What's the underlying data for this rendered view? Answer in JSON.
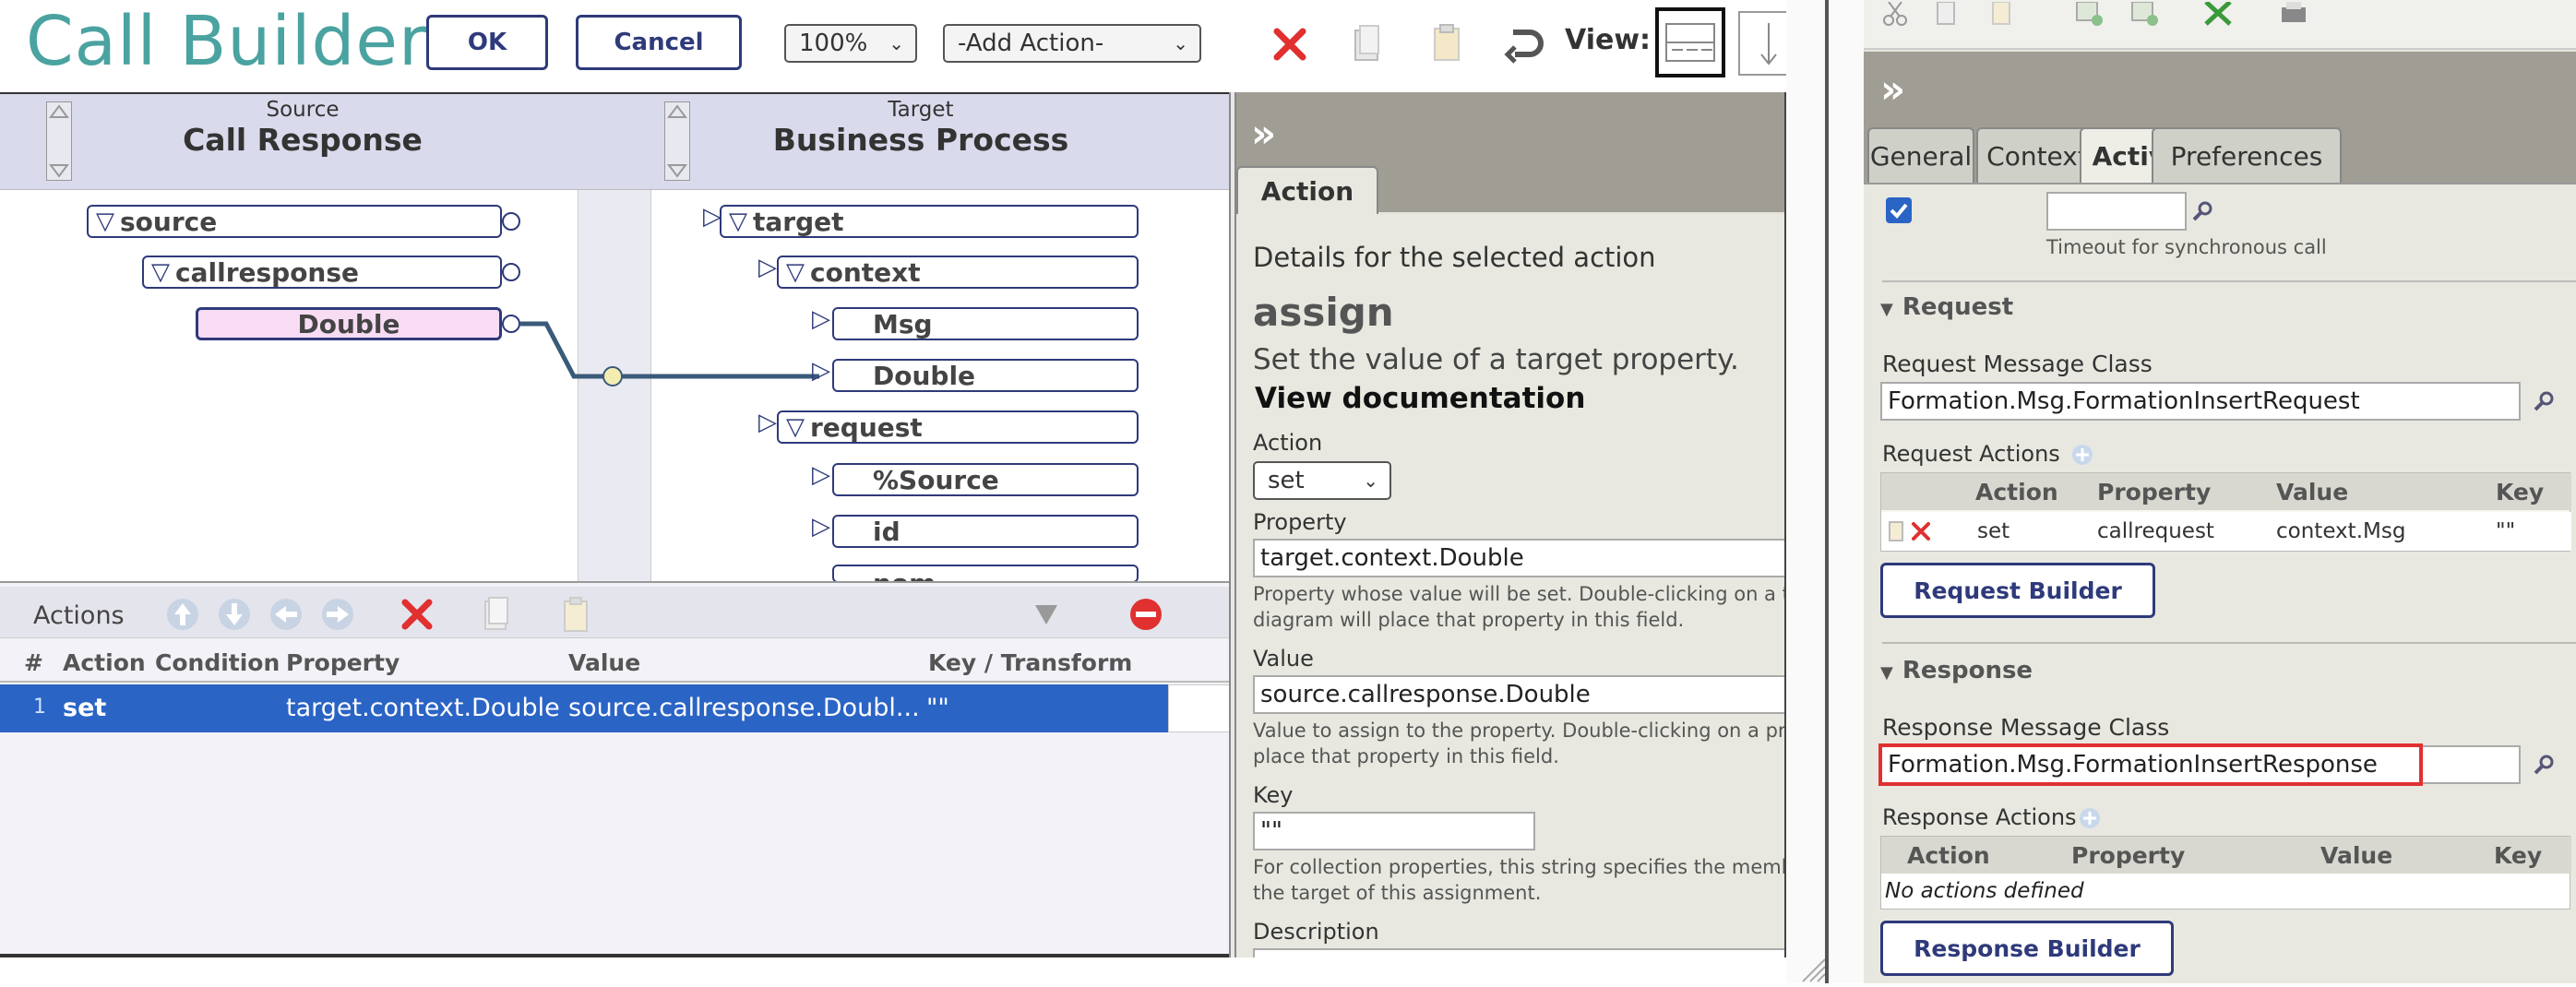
{
  "toolbar": {
    "title": "Call Builder",
    "ok_label": "OK",
    "cancel_label": "Cancel",
    "zoom_value": "100%",
    "add_action_value": "-Add Action-",
    "view_label": "View:"
  },
  "diagram": {
    "source_caption": "Source",
    "source_title": "Call Response",
    "target_caption": "Target",
    "target_title": "Business Process",
    "source_nodes": [
      "source",
      "callresponse",
      "Double"
    ],
    "target_nodes": [
      "target",
      "context",
      "Msg",
      "Double",
      "request",
      "%Source",
      "id",
      "nom"
    ]
  },
  "actions_panel": {
    "label": "Actions",
    "columns": [
      "#",
      "Action",
      "Condition",
      "Property",
      "Value",
      "Key / Transform"
    ],
    "rows": [
      {
        "num": "1",
        "action": "set",
        "condition": "",
        "property": "target.context.Double",
        "value": "source.callresponse.Doubl...",
        "key": "\"\""
      }
    ]
  },
  "action_details": {
    "tab_label": "Action",
    "intro": "Details for the selected action",
    "heading": "assign",
    "description": "Set the value of a target property.",
    "doc_link": "View documentation",
    "action_label": "Action",
    "action_value": "set",
    "property_label": "Property",
    "property_value": "target.context.Double",
    "property_help_1": "Property whose value will be set. Double-clicking on a targ",
    "property_help_2": "diagram will place that property in this field.",
    "value_label": "Value",
    "value_value": "source.callresponse.Double",
    "value_help_1": "Value to assign to the property. Double-clicking on a prop",
    "value_help_2": "place that property in this field.",
    "key_label": "Key",
    "key_value": "\"\"",
    "key_help_1": "For collection properties, this string specifies the member o",
    "key_help_2": "the target of this assignment.",
    "description_label": "Description"
  },
  "settings_panel": {
    "tabs": [
      "General",
      "Context",
      "Activity",
      "Preferences"
    ],
    "active_tab": "Activity",
    "timeout_help": "Timeout for synchronous call",
    "request": {
      "section_title": "Request",
      "message_class_label": "Request Message Class",
      "message_class_value": "Formation.Msg.FormationInsertRequest",
      "actions_label": "Request Actions",
      "columns": [
        "Action",
        "Property",
        "Value",
        "Key"
      ],
      "rows": [
        {
          "action": "set",
          "property": "callrequest",
          "value": "context.Msg",
          "key": "\"\""
        }
      ],
      "builder_button": "Request Builder"
    },
    "response": {
      "section_title": "Response",
      "message_class_label": "Response Message Class",
      "message_class_value": "Formation.Msg.FormationInsertResponse",
      "actions_label": "Response Actions",
      "columns": [
        "Action",
        "Property",
        "Value",
        "Key"
      ],
      "empty_text": "No actions defined",
      "builder_button": "Response Builder"
    }
  },
  "colors": {
    "title_teal": "#4aa3a0",
    "accent_navy": "#2e3a7a",
    "selected_row": "#2a64c5",
    "highlight_red": "#e03030",
    "panel_olive": "#e8e8e0"
  }
}
